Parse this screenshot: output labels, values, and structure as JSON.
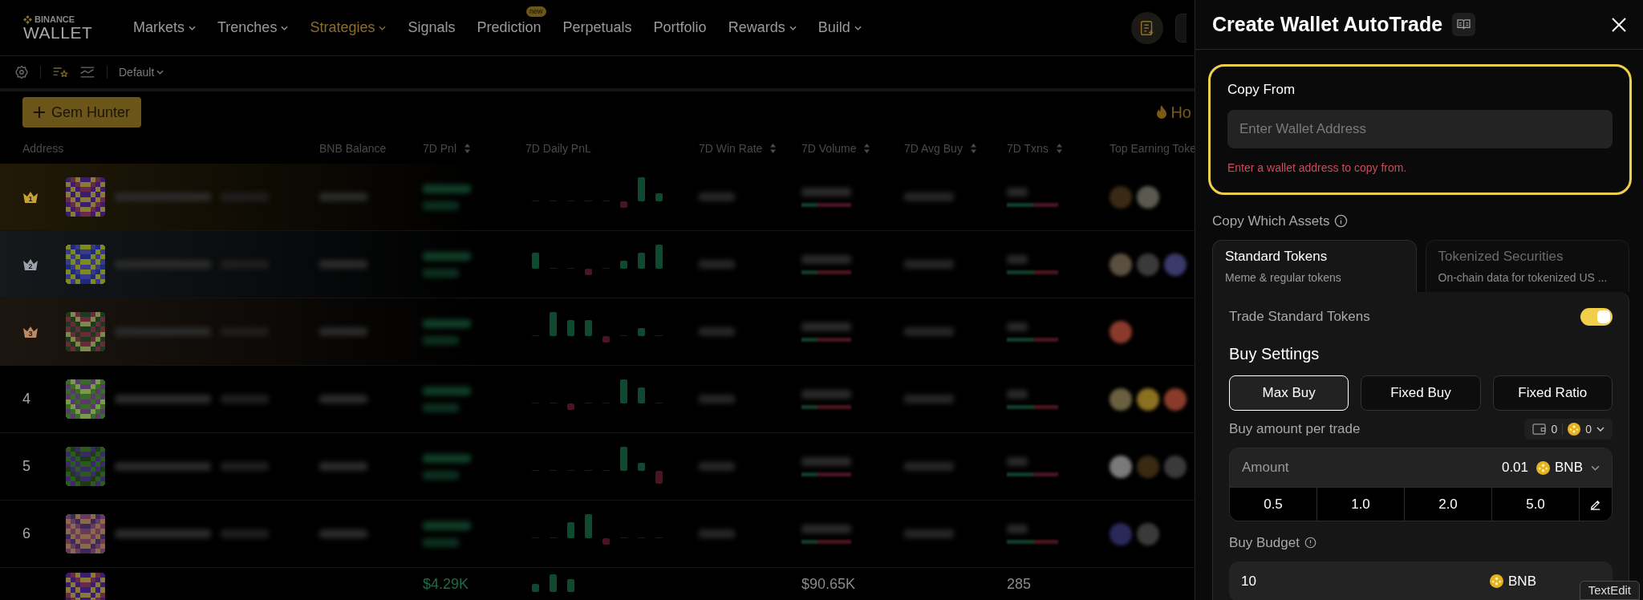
{
  "header": {
    "logo": {
      "top": "BINANCE",
      "bottom": "WALLET"
    },
    "nav": [
      {
        "label": "Markets",
        "selected": false,
        "dropdown": true
      },
      {
        "label": "Trenches",
        "selected": false,
        "dropdown": true
      },
      {
        "label": "Strategies",
        "selected": true,
        "dropdown": true
      },
      {
        "label": "Signals",
        "selected": false,
        "dropdown": false
      },
      {
        "label": "Prediction",
        "selected": false,
        "dropdown": false,
        "badge": "new"
      },
      {
        "label": "Perpetuals",
        "selected": false,
        "dropdown": false
      },
      {
        "label": "Portfolio",
        "selected": false,
        "dropdown": false
      },
      {
        "label": "Rewards",
        "selected": false,
        "dropdown": true
      },
      {
        "label": "Build",
        "selected": false,
        "dropdown": true
      }
    ]
  },
  "toolbar": {
    "preset": "Default"
  },
  "gem_hunter": {
    "label": "Gem Hunter"
  },
  "hot_label": "Ho",
  "table": {
    "columns": [
      {
        "label": "Address",
        "sortable": false
      },
      {
        "label": "BNB Balance",
        "sortable": false
      },
      {
        "label": "7D Pnl",
        "sortable": true
      },
      {
        "label": "7D Daily PnL",
        "sortable": false
      },
      {
        "label": "7D Win Rate",
        "sortable": true
      },
      {
        "label": "7D Volume",
        "sortable": true
      },
      {
        "label": "7D Avg Buy",
        "sortable": true
      },
      {
        "label": "7D Txns",
        "sortable": true
      },
      {
        "label": "Top Earning Toke"
      }
    ],
    "rows": [
      {
        "kind": "crown",
        "rank": "1",
        "color": "#c9a233",
        "blurred": true
      },
      {
        "kind": "crown",
        "rank": "2",
        "color": "#9aa3ad",
        "blurred": true
      },
      {
        "kind": "crown",
        "rank": "3",
        "color": "#b98a63",
        "blurred": true
      },
      {
        "kind": "number",
        "rank": "4",
        "blurred": true
      },
      {
        "kind": "number",
        "rank": "5",
        "blurred": true
      },
      {
        "kind": "number",
        "rank": "6",
        "blurred": true
      },
      {
        "kind": "partial",
        "blurred": false,
        "pnl": "$4.29K",
        "volume": "$90.65K",
        "txns": "285"
      }
    ]
  },
  "panel": {
    "title": "Create Wallet AutoTrade",
    "copy_from": {
      "label": "Copy From",
      "placeholder": "Enter Wallet Address",
      "error": "Enter a wallet address to copy from.",
      "highlighted": true
    },
    "assets": {
      "label": "Copy Which Assets",
      "tabs": [
        {
          "title": "Standard Tokens",
          "subtitle": "Meme & regular tokens",
          "selected": true
        },
        {
          "title": "Tokenized Securities",
          "subtitle": "On-chain data for tokenized US ...",
          "selected": false
        }
      ]
    },
    "trade_toggle": {
      "label": "Trade Standard Tokens",
      "on": true
    },
    "buy_settings": {
      "title": "Buy Settings",
      "modes": [
        {
          "label": "Max Buy",
          "selected": true
        },
        {
          "label": "Fixed Buy",
          "selected": false
        },
        {
          "label": "Fixed Ratio",
          "selected": false
        }
      ],
      "amount_label": "Buy amount per trade",
      "balance": {
        "wallets": "0",
        "bnb": "0"
      },
      "amount": {
        "label": "Amount",
        "value": "0.01",
        "currency": "BNB"
      },
      "presets": [
        "0.5",
        "1.0",
        "2.0",
        "5.0"
      ],
      "budget": {
        "label": "Buy Budget",
        "value": "10",
        "currency": "BNB"
      }
    }
  },
  "tooltip": "TextEdit"
}
